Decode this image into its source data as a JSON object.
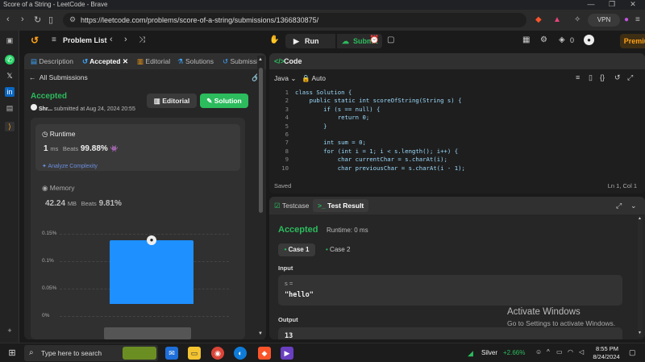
{
  "window": {
    "title": "Score of a String - LeetCode - Brave"
  },
  "browser": {
    "url": "https://leetcode.com/problems/score-of-a-string/submissions/1366830875/",
    "vpn_label": "VPN"
  },
  "header": {
    "problem_list": "Problem List",
    "run_label": "Run",
    "submit_label": "Submit",
    "notif_count": "0",
    "premium_label": "Premium"
  },
  "left": {
    "tabs": [
      {
        "label": "Description"
      },
      {
        "label": "Accepted"
      },
      {
        "label": "Editorial"
      },
      {
        "label": "Solutions"
      },
      {
        "label": "Submissi"
      }
    ],
    "all_submissions": "All Submissions",
    "status": "Accepted",
    "user": "Shr...",
    "submitted_text": "submitted at Aug 24, 2024 20:55",
    "editorial_btn": "Editorial",
    "solution_btn": "Solution",
    "runtime": {
      "title": "Runtime",
      "value": "1",
      "unit": "ms",
      "beats_label": "Beats",
      "beats_value": "99.88%"
    },
    "analyze": "Analyze Complexity",
    "memory": {
      "title": "Memory",
      "value": "42.24",
      "unit": "MB",
      "beats_label": "Beats",
      "beats_value": "9.81%"
    }
  },
  "chart_data": {
    "type": "bar",
    "yticks": [
      "0.15%",
      "0.1%",
      "0.05%",
      "0%"
    ],
    "ylim": [
      0,
      0.15
    ],
    "values": [
      0.12
    ],
    "highlight_color": "#1e90ff"
  },
  "code": {
    "header": "Code",
    "language": "Java",
    "mode": "Auto",
    "lines": [
      {
        "n": "1",
        "text": "class Solution {"
      },
      {
        "n": "2",
        "text": "    public static int scoreOfString(String s) {"
      },
      {
        "n": "3",
        "text": "        if (s == null) {"
      },
      {
        "n": "4",
        "text": "            return 0;"
      },
      {
        "n": "5",
        "text": "        }"
      },
      {
        "n": "6",
        "text": ""
      },
      {
        "n": "7",
        "text": "        int sum = 0;"
      },
      {
        "n": "8",
        "text": "        for (int i = 1; i < s.length(); i++) {"
      },
      {
        "n": "9",
        "text": "            char currentChar = s.charAt(i);"
      },
      {
        "n": "10",
        "text": "            char previousChar = s.charAt(i - 1);"
      }
    ],
    "saved": "Saved",
    "position": "Ln 1, Col 1"
  },
  "test": {
    "testcase_tab": "Testcase",
    "result_tab": "Test Result",
    "status": "Accepted",
    "runtime": "Runtime: 0 ms",
    "case1": "Case 1",
    "case2": "Case 2",
    "input_label": "Input",
    "input_var": "s =",
    "input_value": "\"hello\"",
    "output_label": "Output",
    "output_value": "13"
  },
  "watermark": {
    "line1": "Activate Windows",
    "line2": "Go to Settings to activate Windows."
  },
  "taskbar": {
    "search_placeholder": "Type here to search",
    "stock_name": "Silver",
    "stock_change": "+2.66%",
    "time": "8:55 PM",
    "date": "8/24/2024"
  }
}
